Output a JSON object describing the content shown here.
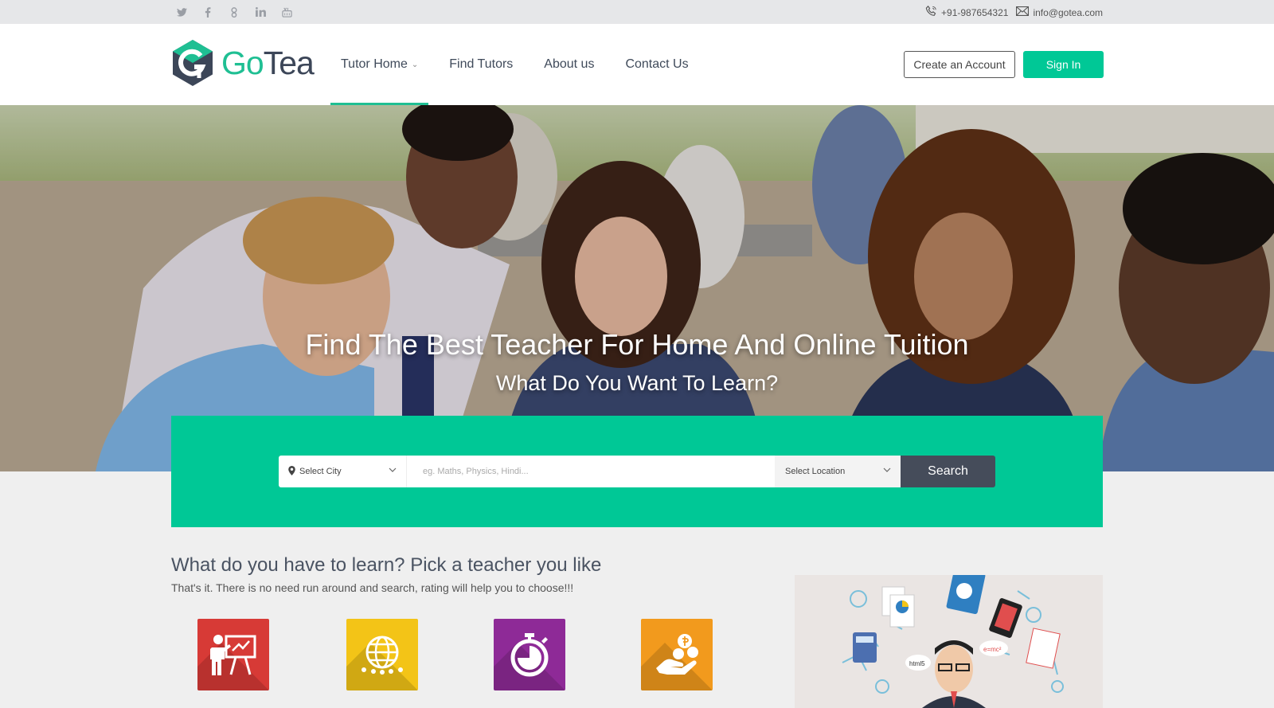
{
  "topbar": {
    "social_icons": [
      "twitter-icon",
      "facebook-icon",
      "google-plus-icon",
      "linkedin-icon",
      "youtube-icon"
    ],
    "phone": "+91-987654321",
    "email": "info@gotea.com"
  },
  "brand": {
    "logo_mark": "GT",
    "name_go": "Go",
    "name_tea": "Tea",
    "accent": "#00c896"
  },
  "nav": {
    "items": [
      {
        "label": "Tutor Home",
        "active": true,
        "has_caret": true
      },
      {
        "label": "Find Tutors"
      },
      {
        "label": "About us"
      },
      {
        "label": "Contact Us"
      }
    ]
  },
  "header_actions": {
    "create_account": "Create an Account",
    "sign_in": "Sign In"
  },
  "hero": {
    "title": "Find The Best Teacher For Home And Online Tuition",
    "subtitle": "What Do You Want To Learn?"
  },
  "search": {
    "city": "Select City",
    "query_placeholder": "eg. Maths, Physics, Hindi...",
    "location": "Select Location",
    "button": "Search"
  },
  "section": {
    "title": "What do you have to learn? Pick a teacher you like",
    "subtitle": "That's it. There is no need run around and search, rating will help you to choose!!!",
    "features": [
      {
        "icon": "teacher-board-icon",
        "color": "#d73a36"
      },
      {
        "icon": "globe-people-icon",
        "color": "#f3c417"
      },
      {
        "icon": "stopwatch-icon",
        "color": "#8e2a97"
      },
      {
        "icon": "money-hand-icon",
        "color": "#f29a1d"
      }
    ],
    "illustration_labels": {
      "html": "html5",
      "formula": "e=mc²"
    }
  }
}
